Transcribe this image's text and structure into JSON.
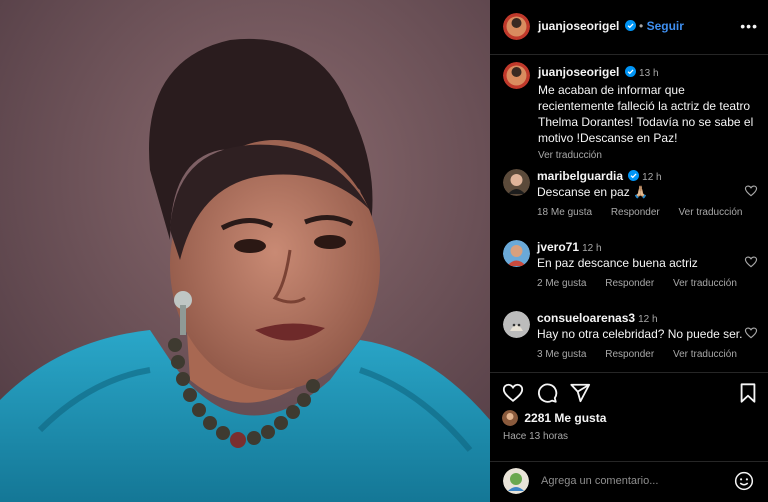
{
  "post": {
    "author": "juanjoseorigel",
    "follow_label": "Seguir",
    "more_label": "•••",
    "caption_time": "13 h",
    "caption_text": "Me acaban de informar que recientemente falleció la actriz de teatro Thelma Dorantes! Todavía no se sabe el motivo !Descanse en Paz!",
    "caption_translate": "Ver traducción"
  },
  "comments": [
    {
      "user": "maribelguardia",
      "verified": true,
      "time": "12 h",
      "text": "Descanse en paz 🙏🏼",
      "likes": "18 Me gusta",
      "reply": "Responder",
      "translate": "Ver traducción"
    },
    {
      "user": "jvero71",
      "verified": false,
      "time": "12 h",
      "text": "En paz descance buena actriz",
      "likes": "2 Me gusta",
      "reply": "Responder",
      "translate": "Ver traducción"
    },
    {
      "user": "consueloarenas3",
      "verified": false,
      "time": "12 h",
      "text": "Hay no otra celebridad? No puede ser.",
      "likes": "3 Me gusta",
      "reply": "Responder",
      "translate": "Ver traducción"
    }
  ],
  "stats": {
    "likes_label": "2281 Me gusta",
    "posted_ago": "Hace 13 horas"
  },
  "composer": {
    "placeholder": "Agrega un comentario..."
  },
  "colors": {
    "background": "#000000",
    "link_blue": "#3f8ff0",
    "verified_blue": "#0095f6",
    "muted_text": "#a8a8a8"
  },
  "icons": {
    "like": "heart-icon",
    "comment": "comment-icon",
    "share": "send-icon",
    "save": "bookmark-icon",
    "emoji": "emoji-icon"
  }
}
